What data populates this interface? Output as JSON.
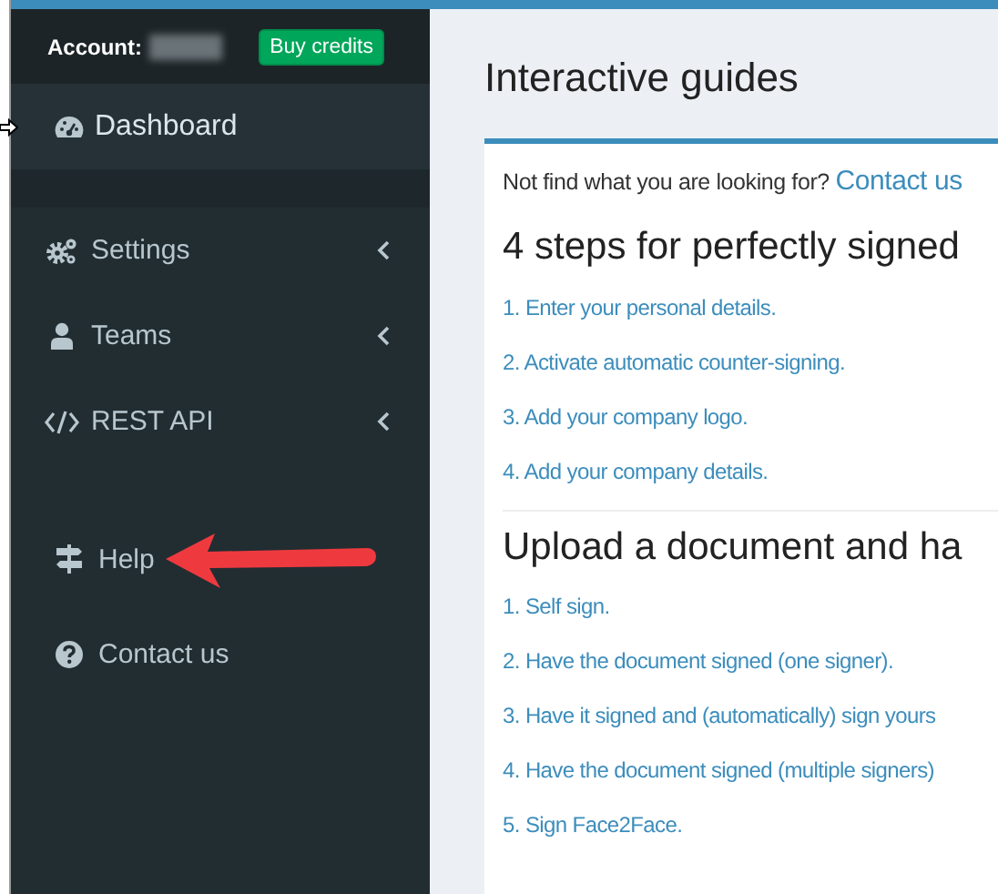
{
  "sidebar": {
    "account_label": "Account:",
    "buy_button": "Buy credits",
    "main_menu": [
      {
        "label": "Dashboard",
        "selected": true,
        "has_submenu": false
      },
      {
        "label": "Settings",
        "selected": false,
        "has_submenu": true
      },
      {
        "label": "Teams",
        "selected": false,
        "has_submenu": true
      },
      {
        "label": "REST API",
        "selected": false,
        "has_submenu": true
      }
    ],
    "help_menu": [
      {
        "label": "Help",
        "selected": false,
        "has_submenu": false
      },
      {
        "label": "Contact us",
        "selected": false,
        "has_submenu": false
      }
    ]
  },
  "main": {
    "page_title": "Interactive guides",
    "intro": "Not find what you are looking for?",
    "intro_link": "Contact us",
    "sections": [
      {
        "heading": "4 steps for perfectly signed",
        "steps": [
          "1. Enter your personal details.",
          "2. Activate automatic counter-signing.",
          "3. Add your company logo.",
          "4. Add your company details."
        ]
      },
      {
        "heading": "Upload a document and ha",
        "steps": [
          "1. Self sign.",
          "2. Have the document signed (one signer).",
          "3. Have it signed and (automatically) sign yours",
          "4. Have the document signed (multiple signers)",
          "5. Sign Face2Face."
        ]
      }
    ]
  }
}
